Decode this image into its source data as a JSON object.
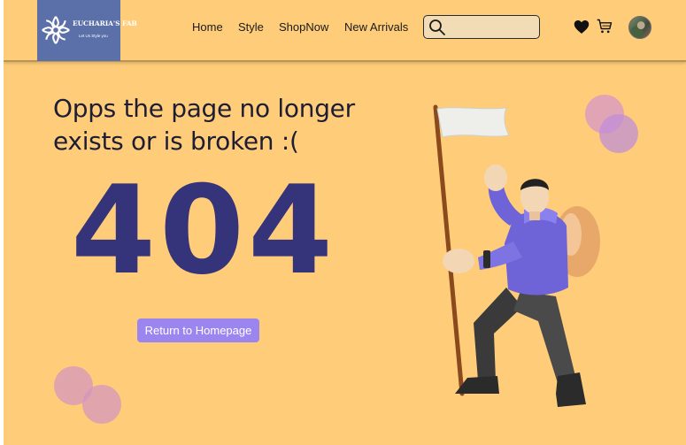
{
  "brand": {
    "name": "EUCHARIA'S FAB",
    "tagline": "Let Us Style you"
  },
  "nav": {
    "items": [
      {
        "label": "Home"
      },
      {
        "label": "Style"
      },
      {
        "label": "ShopNow"
      },
      {
        "label": "New Arrivals"
      }
    ]
  },
  "search": {
    "value": "",
    "placeholder": ""
  },
  "icons": {
    "search": "search-icon",
    "wishlist": "heart-icon",
    "cart": "cart-icon"
  },
  "error": {
    "message": "Opps the page no longer exists or is broken :(",
    "code": "404",
    "button_label": "Return to Homepage"
  },
  "colors": {
    "background": "#ffcd7a",
    "accent": "#9b86f0",
    "code": "#35337a",
    "logo_bg": "#5b6fa8"
  }
}
